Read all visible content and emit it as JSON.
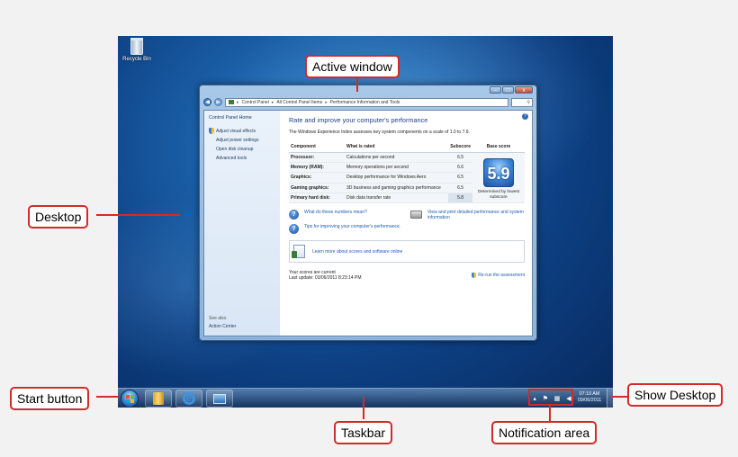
{
  "desktop": {
    "recycle_bin_label": "Recycle Bin"
  },
  "window": {
    "address": {
      "crumbs": [
        "Control Panel",
        "All Control Panel Items",
        "Performance Information and Tools"
      ]
    },
    "sidebar": {
      "home": "Control Panel Home",
      "links": [
        "Adjust visual effects",
        "Adjust power settings",
        "Open disk cleanup",
        "Advanced tools"
      ],
      "see_also": "See also",
      "action_center": "Action Center"
    },
    "main": {
      "title": "Rate and improve your computer's performance",
      "description": "The Windows Experience Index assesses key system components on a scale of 1.0 to 7.9.",
      "columns": [
        "Component",
        "What is rated",
        "Subscore",
        "Base score"
      ],
      "rows": [
        {
          "component": "Processor:",
          "rated": "Calculations per second",
          "subscore": "6.5"
        },
        {
          "component": "Memory (RAM):",
          "rated": "Memory operations per second",
          "subscore": "6.6"
        },
        {
          "component": "Graphics:",
          "rated": "Desktop performance for Windows Aero",
          "subscore": "6.5"
        },
        {
          "component": "Gaming graphics:",
          "rated": "3D business and gaming graphics performance",
          "subscore": "6.5"
        },
        {
          "component": "Primary hard disk:",
          "rated": "Disk data transfer rate",
          "subscore": "5.8"
        }
      ],
      "base_score": "5.9",
      "base_caption": "Determined by lowest subscore",
      "links": {
        "what_mean": "What do these numbers mean?",
        "tips": "Tips for improving your computer's performance.",
        "view_print": "View and print detailed performance and system information",
        "learn_more": "Learn more about scores and software online"
      },
      "footer": {
        "current": "Your scores are current",
        "last_update": "Last update: 03/06/2011 8:23:14 PM",
        "rerun": "Re-run the assessment"
      }
    }
  },
  "taskbar": {
    "clock_time": "07:10 AM",
    "clock_date": "09/06/2011"
  },
  "callouts": {
    "active_window": "Active window",
    "desktop": "Desktop",
    "start_button": "Start button",
    "taskbar": "Taskbar",
    "notification_area": "Notification area",
    "show_desktop": "Show Desktop"
  },
  "colors": {
    "callout_border": "#d42a2a",
    "link_blue": "#1e5cb3",
    "title_blue": "#1e3f8f"
  }
}
